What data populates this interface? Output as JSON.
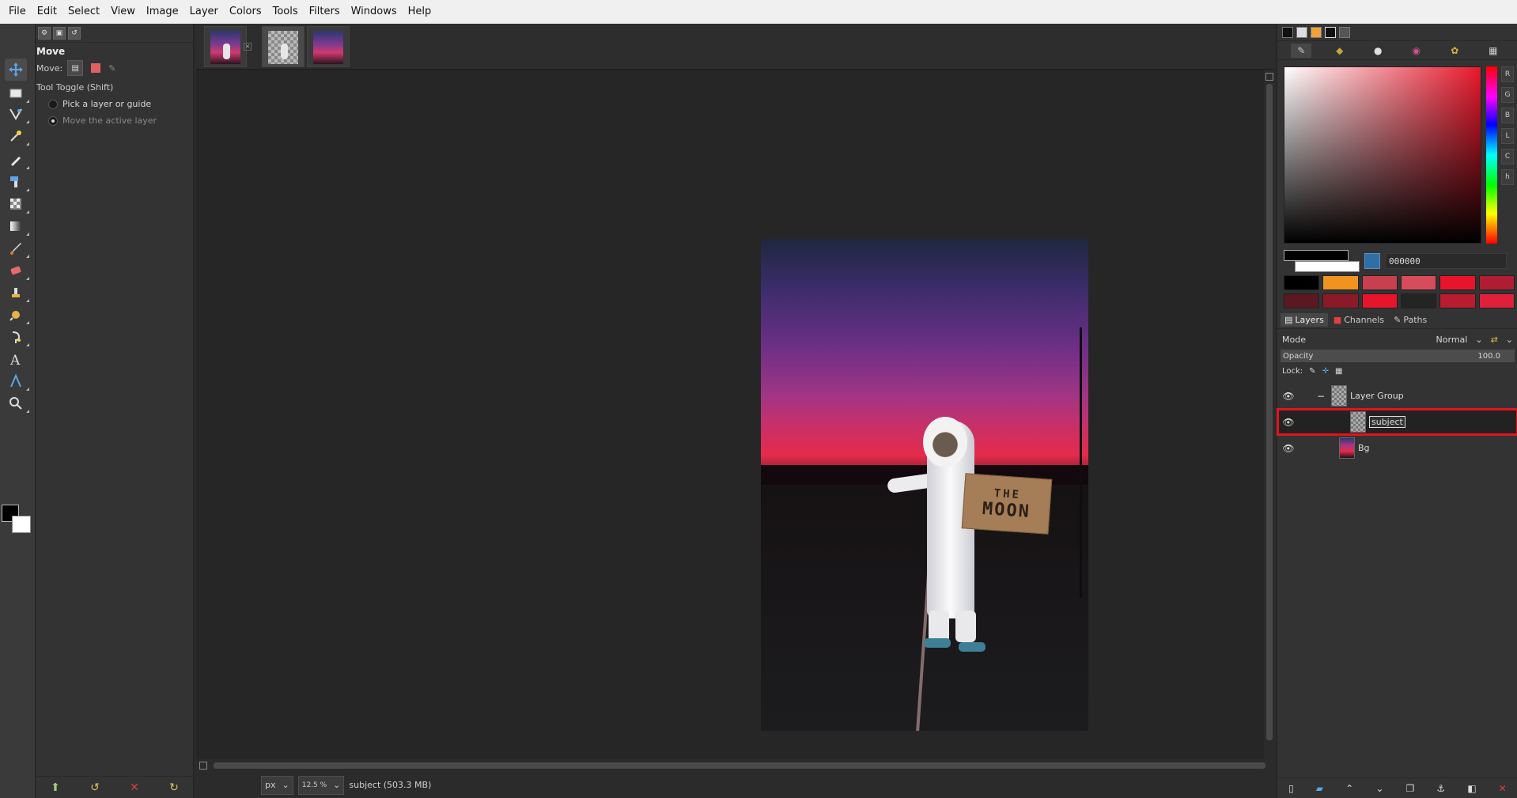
{
  "menu": [
    "File",
    "Edit",
    "Select",
    "View",
    "Image",
    "Layer",
    "Colors",
    "Tools",
    "Filters",
    "Windows",
    "Help"
  ],
  "tool_options": {
    "title": "Move",
    "move_label": "Move:",
    "toggle_label": "Tool Toggle  (Shift)",
    "option1": "Pick a layer or guide",
    "option2": "Move the active layer"
  },
  "canvas": {
    "sign_line1": "THE",
    "sign_line2": "MOON"
  },
  "status": {
    "unit": "px",
    "zoom": "12.5 %",
    "info": "subject (503.3 MB)"
  },
  "color": {
    "hex": "000000",
    "channels": [
      "R",
      "G",
      "B",
      "L",
      "C",
      "h"
    ],
    "history": [
      "#000000",
      "#f0931f",
      "#c8404e",
      "#d74c5b",
      "#e8142c",
      "#b01d33",
      "#5a1820",
      "#8a1a28",
      "#e8142c",
      "#242424",
      "#b81c2e",
      "#e0203a"
    ]
  },
  "layers_panel": {
    "tabs": [
      "Layers",
      "Channels",
      "Paths"
    ],
    "mode_label": "Mode",
    "mode_value": "Normal",
    "opacity_label": "Opacity",
    "opacity_value": "100.0",
    "lock_label": "Lock:",
    "layers": [
      {
        "name": "Layer Group"
      },
      {
        "name": "subject"
      },
      {
        "name": "Bg"
      }
    ]
  }
}
